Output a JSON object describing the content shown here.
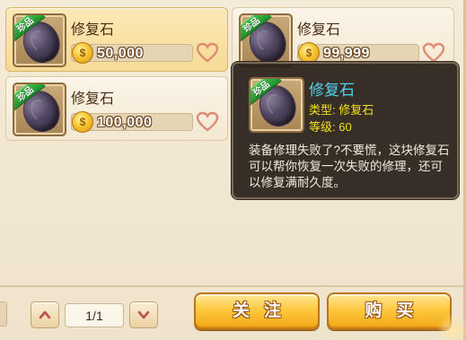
{
  "items": [
    {
      "name": "修复石",
      "badge": "珍品",
      "price": "50,000",
      "selected": true
    },
    {
      "name": "修复石",
      "badge": "珍品",
      "price": "99,999",
      "selected": false
    },
    {
      "name": "修复石",
      "badge": "珍品",
      "price": "100,000",
      "selected": false
    }
  ],
  "tooltip": {
    "badge": "珍品",
    "name": "修复石",
    "type_line": "类型: 修复石",
    "level_line": "等级: 60",
    "description": "装备修理失败了?不要慌，这块修复石可以帮你恢复一次失败的修理，还可以修复满耐久度。"
  },
  "pagination": {
    "page": "1/1"
  },
  "buttons": {
    "follow": "关注",
    "buy": "购买"
  },
  "icons": {
    "coin": "coin-icon",
    "heart": "heart-outline-icon",
    "up": "chevron-up-icon",
    "down": "chevron-down-icon"
  },
  "colors": {
    "tooltip_title": "#4fd4f0",
    "tooltip_attr": "#f4e020",
    "badge": "#2ea83a",
    "button": "#ffc93f"
  }
}
